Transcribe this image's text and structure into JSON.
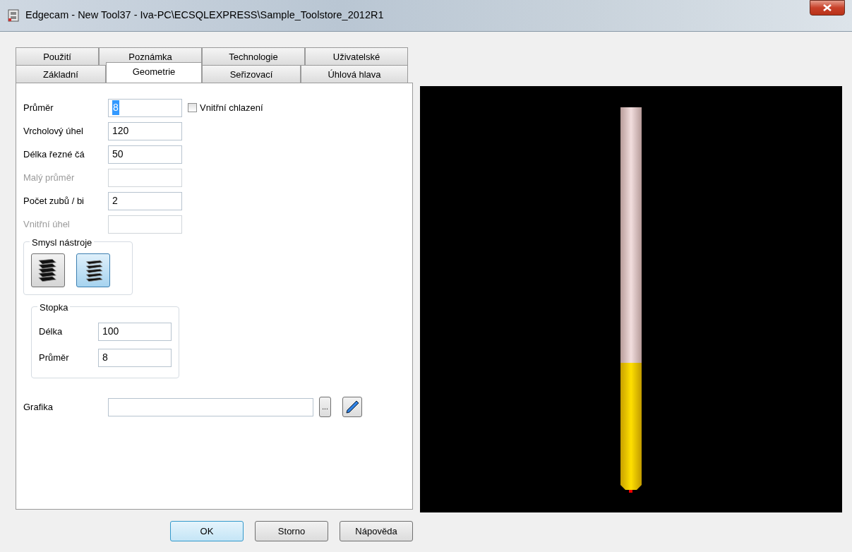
{
  "window": {
    "title": "Edgecam - New Tool37 - Iva-PC\\ECSQLEXPRESS\\Sample_Toolstore_2012R1"
  },
  "tab_rows": [
    [
      {
        "label": "Použití",
        "selected": false
      },
      {
        "label": "Poznámka",
        "selected": false
      },
      {
        "label": "Technologie",
        "selected": false
      },
      {
        "label": "Uživatelské",
        "selected": false
      }
    ],
    [
      {
        "label": "Základní",
        "selected": false
      },
      {
        "label": "Geometrie",
        "selected": true
      },
      {
        "label": "Seřizovací",
        "selected": false
      },
      {
        "label": "Úhlová hlava",
        "selected": false
      }
    ]
  ],
  "fields": [
    {
      "label": "Průměr",
      "value": "8",
      "disabled": false,
      "focused": true
    },
    {
      "label": "Vrcholový úhel",
      "value": "120",
      "disabled": false,
      "focused": false
    },
    {
      "label": "Délka řezné čá",
      "value": "50",
      "disabled": false,
      "focused": false
    },
    {
      "label": "Malý průměr",
      "disabled": true,
      "focused": false
    },
    {
      "label": "Počet zubů / bi",
      "value": "2",
      "disabled": false,
      "focused": false
    },
    {
      "label": "Vnitřní úhel",
      "disabled": true,
      "focused": false
    }
  ],
  "coolant": {
    "label": "Vnitřní chlazení",
    "checked": false
  },
  "tool_direction": {
    "title": "Smysl nástroje",
    "options": [
      {
        "selected": false
      },
      {
        "selected": true
      }
    ]
  },
  "shank": {
    "title": "Stopka",
    "fields": [
      {
        "label": "Délka",
        "value": "100"
      },
      {
        "label": "Průměr",
        "value": "8"
      }
    ]
  },
  "graphics": {
    "label": "Grafika",
    "browse": "..."
  },
  "buttons": [
    {
      "label": "OK",
      "default": true
    },
    {
      "label": "Storno",
      "default": false
    },
    {
      "label": "Nápověda",
      "default": false
    }
  ]
}
